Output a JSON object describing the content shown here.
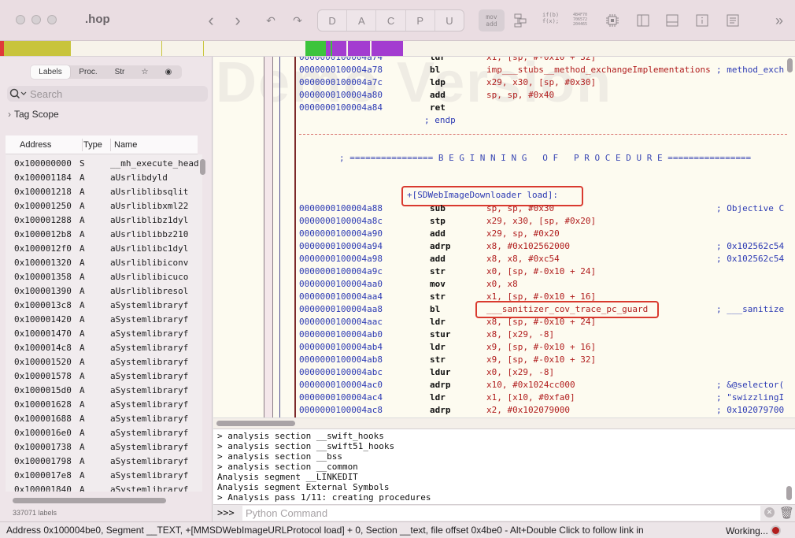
{
  "window": {
    "title": ".hop"
  },
  "toolbar": {
    "back_icon": "‹",
    "forward_icon": "›",
    "undo_icon": "↶",
    "redo_icon": "↷",
    "mode_tabs": [
      "D",
      "A",
      "C",
      "P",
      "U"
    ],
    "movadd": "mov\nadd",
    "ifb": "if(b)\nf(x);",
    "hex": "4B4F70\n706572\n204465",
    "more_icon": "»"
  },
  "left": {
    "tabs": [
      "Labels",
      "Proc.",
      "Str",
      "☆",
      "◉"
    ],
    "search_placeholder": "Search",
    "tag_scope": "Tag Scope",
    "columns": {
      "address": "Address",
      "type": "Type",
      "name": "Name"
    },
    "symbols": [
      {
        "addr": "0x100000000",
        "type": "S",
        "name": "__mh_execute_head"
      },
      {
        "addr": "0x100001184",
        "type": "A",
        "name": "aUsrlibdyld"
      },
      {
        "addr": "0x100001218",
        "type": "A",
        "name": "aUsrliblibsqlit"
      },
      {
        "addr": "0x100001250",
        "type": "A",
        "name": "aUsrliblibxml22"
      },
      {
        "addr": "0x100001288",
        "type": "A",
        "name": "aUsrliblibz1dyl"
      },
      {
        "addr": "0x1000012b8",
        "type": "A",
        "name": "aUsrliblibbz210"
      },
      {
        "addr": "0x1000012f0",
        "type": "A",
        "name": "aUsrliblibc1dyl"
      },
      {
        "addr": "0x100001320",
        "type": "A",
        "name": "aUsrliblibiconv"
      },
      {
        "addr": "0x100001358",
        "type": "A",
        "name": "aUsrliblibicuco"
      },
      {
        "addr": "0x100001390",
        "type": "A",
        "name": "aUsrliblibresol"
      },
      {
        "addr": "0x1000013c8",
        "type": "A",
        "name": "aSystemlibraryf"
      },
      {
        "addr": "0x100001420",
        "type": "A",
        "name": "aSystemlibraryf"
      },
      {
        "addr": "0x100001470",
        "type": "A",
        "name": "aSystemlibraryf"
      },
      {
        "addr": "0x1000014c8",
        "type": "A",
        "name": "aSystemlibraryf"
      },
      {
        "addr": "0x100001520",
        "type": "A",
        "name": "aSystemlibraryf"
      },
      {
        "addr": "0x100001578",
        "type": "A",
        "name": "aSystemlibraryf"
      },
      {
        "addr": "0x1000015d0",
        "type": "A",
        "name": "aSystemlibraryf"
      },
      {
        "addr": "0x100001628",
        "type": "A",
        "name": "aSystemlibraryf"
      },
      {
        "addr": "0x100001688",
        "type": "A",
        "name": "aSystemlibraryf"
      },
      {
        "addr": "0x1000016e0",
        "type": "A",
        "name": "aSystemlibraryf"
      },
      {
        "addr": "0x100001738",
        "type": "A",
        "name": "aSystemlibraryf"
      },
      {
        "addr": "0x100001798",
        "type": "A",
        "name": "aSystemlibraryf"
      },
      {
        "addr": "0x1000017e8",
        "type": "A",
        "name": "aSystemlibraryf"
      },
      {
        "addr": "0x100001840",
        "type": "A",
        "name": "aSystemlibraryf"
      }
    ],
    "label_count": "337071 labels"
  },
  "disasm": {
    "watermark": "Demo Version",
    "lines_top": [
      {
        "addr": "0000000100004a74",
        "mn": "ldr",
        "op": "x1, [sp, #-0x10 + 32]",
        "cm": ""
      },
      {
        "addr": "0000000100004a78",
        "mn": "bl",
        "op": "imp___stubs__method_exchangeImplementations",
        "cm": "; method_exch"
      },
      {
        "addr": "0000000100004a7c",
        "mn": "ldp",
        "op": "x29, x30, [sp, #0x30]",
        "cm": ""
      },
      {
        "addr": "0000000100004a80",
        "mn": "add",
        "op": "sp, sp, #0x40",
        "cm": ""
      },
      {
        "addr": "0000000100004a84",
        "mn": "ret",
        "op": "",
        "cm": ""
      }
    ],
    "endp": "; endp",
    "beginning": "; ================ B E G I N N I N G   O F   P R O C E D U R E ================",
    "proc_name": "+[SDWebImageDownloader load]:",
    "lines": [
      {
        "addr": "0000000100004a88",
        "mn": "sub",
        "op": "sp, sp, #0x30",
        "cm": "; Objective C"
      },
      {
        "addr": "0000000100004a8c",
        "mn": "stp",
        "op": "x29, x30, [sp, #0x20]",
        "cm": ""
      },
      {
        "addr": "0000000100004a90",
        "mn": "add",
        "op": "x29, sp, #0x20",
        "cm": ""
      },
      {
        "addr": "0000000100004a94",
        "mn": "adrp",
        "op": "x8, #0x102562000",
        "cm": "; 0x102562c54"
      },
      {
        "addr": "0000000100004a98",
        "mn": "add",
        "op": "x8, x8, #0xc54",
        "cm": "; 0x102562c54"
      },
      {
        "addr": "0000000100004a9c",
        "mn": "str",
        "op": "x0, [sp, #-0x10 + 24]",
        "cm": ""
      },
      {
        "addr": "0000000100004aa0",
        "mn": "mov",
        "op": "x0, x8",
        "cm": ""
      },
      {
        "addr": "0000000100004aa4",
        "mn": "str",
        "op": "x1, [sp, #-0x10 + 16]",
        "cm": ""
      },
      {
        "addr": "0000000100004aa8",
        "mn": "bl",
        "op": "___sanitizer_cov_trace_pc_guard",
        "cm": "; ___sanitize"
      },
      {
        "addr": "0000000100004aac",
        "mn": "ldr",
        "op": "x8, [sp, #-0x10 + 24]",
        "cm": ""
      },
      {
        "addr": "0000000100004ab0",
        "mn": "stur",
        "op": "x8, [x29, -8]",
        "cm": ""
      },
      {
        "addr": "0000000100004ab4",
        "mn": "ldr",
        "op": "x9, [sp, #-0x10 + 16]",
        "cm": ""
      },
      {
        "addr": "0000000100004ab8",
        "mn": "str",
        "op": "x9, [sp, #-0x10 + 32]",
        "cm": ""
      },
      {
        "addr": "0000000100004abc",
        "mn": "ldur",
        "op": "x0, [x29, -8]",
        "cm": ""
      },
      {
        "addr": "0000000100004ac0",
        "mn": "adrp",
        "op": "x10, #0x1024cc000",
        "cm": "; &@selector("
      },
      {
        "addr": "0000000100004ac4",
        "mn": "ldr",
        "op": "x1, [x10, #0xfa0]",
        "cm": "; \"swizzlingI"
      },
      {
        "addr": "0000000100004ac8",
        "mn": "adrp",
        "op": "x2, #0x102079000",
        "cm": "; 0x102079700"
      }
    ]
  },
  "console": {
    "lines": [
      "> analysis section __swift_hooks",
      "> analysis section __swift51_hooks",
      "> analysis section __bss",
      "> analysis section __common",
      "Analysis segment __LINKEDIT",
      "Analysis segment External Symbols",
      "> Analysis pass 1/11: creating procedures"
    ],
    "prompt": ">>>",
    "placeholder": "Python Command"
  },
  "status": {
    "text": "Address 0x100004be0, Segment __TEXT, +[MMSDWebImageURLProtocol load] + 0, Section __text, file offset 0x4be0 - Alt+Double Click to follow link in",
    "working": "Working..."
  },
  "colors": {
    "titlebar": "#eadde2",
    "address": "#2c3ab3",
    "operand": "#b01d1d",
    "highlight": "#d93a2f",
    "nav_yellow": "#c8c43c",
    "nav_green": "#3cc43c",
    "nav_purple": "#a33cd0"
  }
}
